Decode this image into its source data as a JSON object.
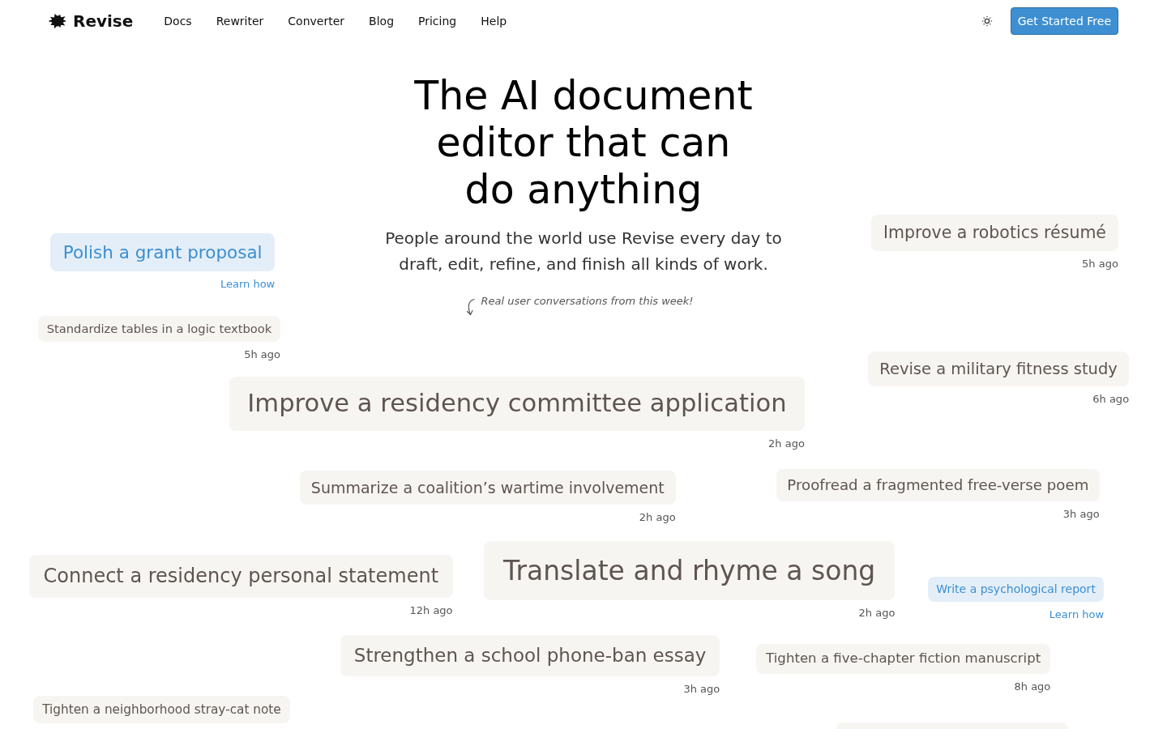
{
  "header": {
    "brand": "Revise",
    "nav": [
      "Docs",
      "Rewriter",
      "Converter",
      "Blog",
      "Pricing",
      "Help"
    ],
    "cta": "Get Started Free"
  },
  "hero": {
    "title": "The AI document editor that can do anything",
    "subtitle": "People around the world use Revise every day to draft, edit, refine, and finish all kinds of work.",
    "note": "Real user conversations from this week!"
  },
  "conversations": [
    {
      "kind": "guide",
      "label": "Polish a grant proposal",
      "link": "Learn how"
    },
    {
      "kind": "conversation",
      "label": "Improve a robotics résumé",
      "time": "5h ago"
    },
    {
      "kind": "conversation",
      "label": "Standardize tables in a logic textbook",
      "time": "5h ago"
    },
    {
      "kind": "conversation",
      "label": "Revise a military fitness study",
      "time": "6h ago"
    },
    {
      "kind": "conversation",
      "label": "Improve a residency committee application",
      "time": "2h ago"
    },
    {
      "kind": "conversation",
      "label": "Summarize a coalition’s wartime involvement",
      "time": "2h ago"
    },
    {
      "kind": "conversation",
      "label": "Proofread a fragmented free-verse poem",
      "time": "3h ago"
    },
    {
      "kind": "conversation",
      "label": "Connect a residency personal statement",
      "time": "12h ago"
    },
    {
      "kind": "conversation",
      "label": "Translate and rhyme a song",
      "time": "2h ago"
    },
    {
      "kind": "guide",
      "label": "Write a psychological report",
      "link": "Learn how"
    },
    {
      "kind": "conversation",
      "label": "Strengthen a school phone-ban essay",
      "time": "3h ago"
    },
    {
      "kind": "conversation",
      "label": "Tighten a five-chapter fiction manuscript",
      "time": "8h ago"
    },
    {
      "kind": "conversation",
      "label": "Tighten a neighborhood stray-cat note"
    },
    {
      "kind": "conversation"
    }
  ]
}
